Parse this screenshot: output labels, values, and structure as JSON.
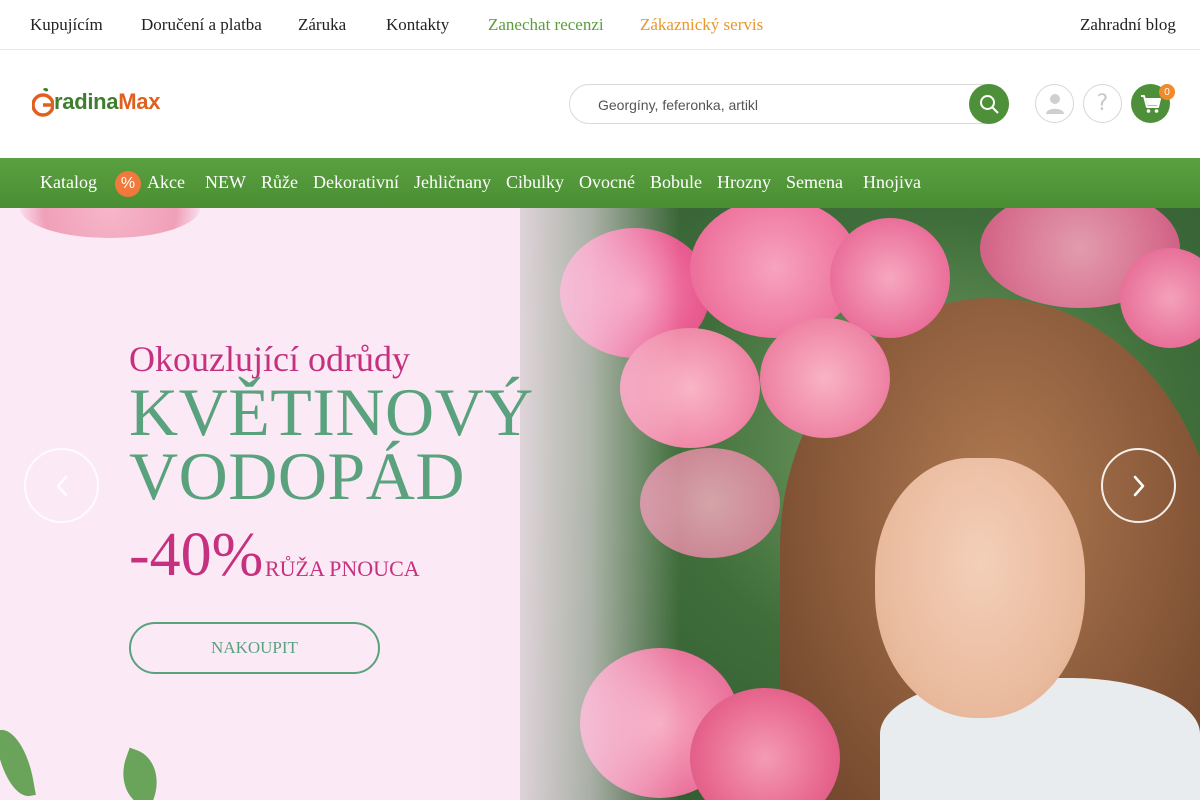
{
  "topbar": {
    "links": [
      {
        "label": "Kupujícím"
      },
      {
        "label": "Doručení a platba"
      },
      {
        "label": "Záruka"
      },
      {
        "label": "Kontakty"
      },
      {
        "label": "Zanechat recenzi"
      },
      {
        "label": "Zákaznický servis"
      }
    ],
    "blog": "Zahradní blog"
  },
  "header": {
    "logo": {
      "part1": "G",
      "part2": "radina",
      "part3": "Max"
    },
    "search_placeholder": "Georgíny, feferonka, artikl",
    "cart_count": "0",
    "help_symbol": "?"
  },
  "nav": {
    "catalog": "Katalog",
    "akce_badge": "%",
    "items": [
      "Akce",
      "NEW",
      "Růže",
      "Dekorativní",
      "Jehličnany",
      "Cibulky",
      "Ovocné",
      "Bobule",
      "Hrozny",
      "Semena",
      "Hnojiva"
    ]
  },
  "hero": {
    "subtitle": "Okouzlující odrůdy",
    "title_line1": "KVĚTINOVÝ",
    "title_line2": "VODOPÁD",
    "discount": "-40%",
    "product": "RŮŽA PNOUCA",
    "button": "NAKOUPIT"
  },
  "colors": {
    "brand_green": "#4e8f3a",
    "accent_orange": "#f08a2b",
    "hero_pink": "#c5317e",
    "hero_green": "#5aa17e"
  },
  "icons": {
    "search": "search-icon",
    "user": "user-icon",
    "help": "help-icon",
    "cart": "cart-icon",
    "prev": "chevron-left-icon",
    "next": "chevron-right-icon"
  }
}
